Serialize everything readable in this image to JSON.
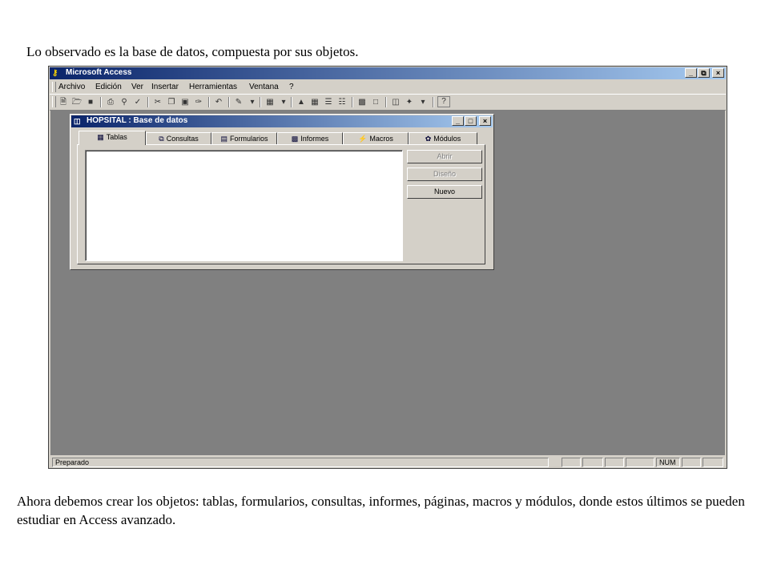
{
  "caption_top": "Lo observado es la base de datos, compuesta por sus objetos.",
  "caption_bottom": "Ahora debemos crear los objetos: tablas, formularios, consultas, informes, páginas, macros y módulos, donde estos últimos se pueden estudiar en Access avanzado.",
  "app": {
    "title": "Microsoft Access",
    "menu": [
      "Archivo",
      "Edición",
      "Ver",
      "Insertar",
      "Herramientas",
      "Ventana",
      "?"
    ],
    "status_text": "Preparado",
    "status_num": "NUM"
  },
  "db_window": {
    "title": "HOPSITAL : Base de datos",
    "tabs": [
      "Tablas",
      "Consultas",
      "Formularios",
      "Informes",
      "Macros",
      "Módulos"
    ],
    "buttons": {
      "open": "Abrir",
      "design": "Diseño",
      "new": "Nuevo"
    }
  },
  "colors": {
    "titlebar_start": "#0a246a",
    "titlebar_end": "#a6caf0",
    "workspace": "#808080",
    "chrome": "#d4d0c8"
  }
}
